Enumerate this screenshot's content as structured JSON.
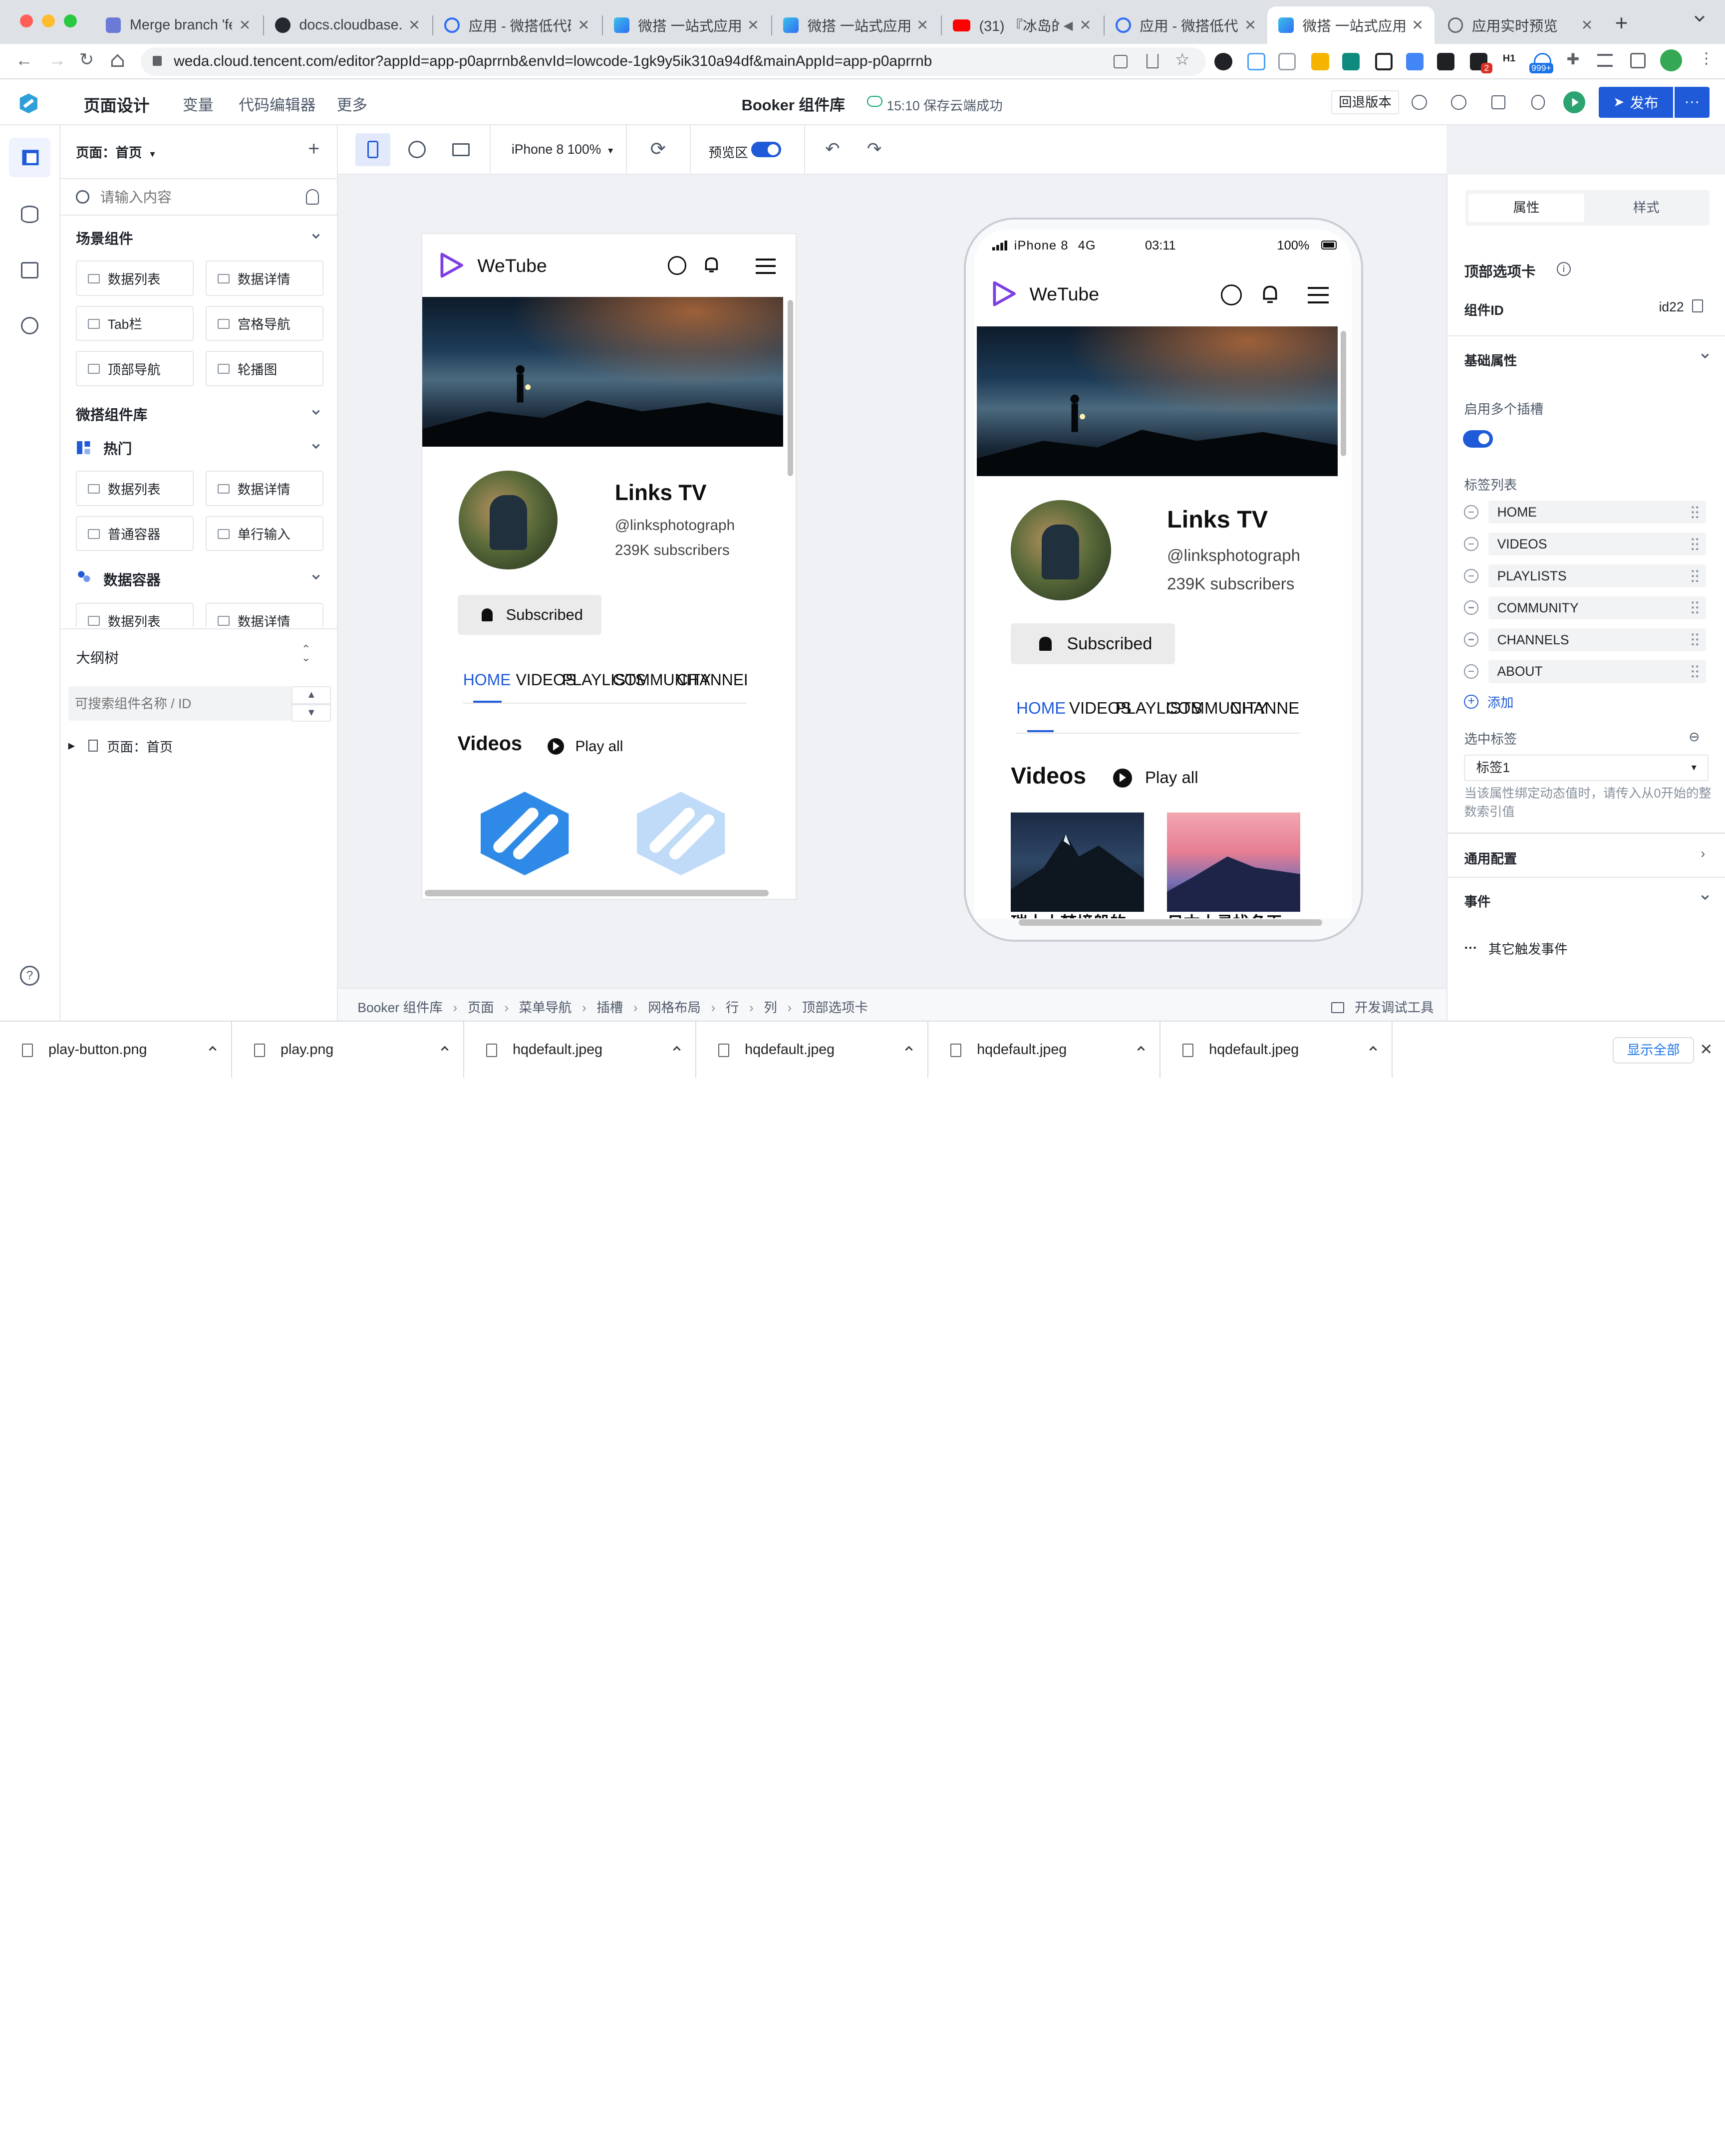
{
  "browser": {
    "tabs": [
      {
        "title": "Merge branch 'fea",
        "icon": "gitlab-icon"
      },
      {
        "title": "docs.cloudbase.ne",
        "icon": "github-icon"
      },
      {
        "title": "应用 - 微搭低代码",
        "icon": "cloud-icon"
      },
      {
        "title": "微搭 一站式应用研",
        "icon": "weda-icon"
      },
      {
        "title": "微搭 一站式应用研",
        "icon": "weda-icon"
      },
      {
        "title": "(31) 『冰岛的",
        "icon": "youtube-icon"
      },
      {
        "title": "应用 - 微搭低代码",
        "icon": "cloud-icon"
      },
      {
        "title": "微搭 一站式应用研",
        "icon": "weda-icon"
      },
      {
        "title": "应用实时预览",
        "icon": "globe-icon"
      }
    ],
    "active_tab": 7,
    "url": "weda.cloud.tencent.com/editor?appId=app-p0aprrnb&envId=lowcode-1gk9y5ik310a94df&mainAppId=app-p0aprrnb",
    "ext_badges": {
      "red": "2",
      "blue": "999+"
    }
  },
  "editor": {
    "title": "页面设计",
    "menus": [
      "变量",
      "代码编辑器",
      "更多"
    ],
    "app_name": "Booker 组件库",
    "save_status": "15:10 保存云端成功",
    "rollback": "回退版本",
    "publish": "发布",
    "brand_color": "#1f5bd9"
  },
  "left_panel": {
    "page_selector": "页面：首页",
    "search_placeholder": "请输入内容",
    "scene_title": "场景组件",
    "scene_items": [
      "数据列表",
      "数据详情",
      "Tab栏",
      "宫格导航",
      "顶部导航",
      "轮播图"
    ],
    "lib_title": "微搭组件库",
    "hot_title": "热门",
    "hot_items": [
      "数据列表",
      "数据详情",
      "普通容器",
      "单行输入"
    ],
    "container_title": "数据容器",
    "container_items": [
      "数据列表",
      "数据详情"
    ],
    "outline_title": "大纲树",
    "outline_placeholder": "可搜索组件名称 / ID",
    "outline_root": "页面：首页"
  },
  "canvas_toolbar": {
    "device": "iPhone 8 100%",
    "preview_label": "预览区",
    "preview_on": true
  },
  "preview": {
    "channel_logo": "WeTube",
    "channel_name": "Links TV",
    "handle": "@linksphotograph",
    "subscribers": "239K subscribers",
    "subscribed_label": "Subscribed",
    "tabs_overlapped": [
      "HOME",
      "VIDEOS",
      "PLAYLISTS",
      "COMMUNITY",
      "CHANNELS"
    ],
    "videos_title": "Videos",
    "play_all": "Play all",
    "status_bar": {
      "carrier": "iPhone 8",
      "network": "4G",
      "time": "03:11",
      "battery": "100%"
    },
    "thumb_captions": [
      "瑞士丨梦境般的",
      "日本丨寻找冬天"
    ]
  },
  "right_panel": {
    "tab_attr": "属性",
    "tab_style": "样式",
    "component_title": "顶部选项卡",
    "component_id_label": "组件ID",
    "component_id": "id22",
    "basic_props": "基础属性",
    "multi_slot_label": "启用多个插槽",
    "multi_slot_on": true,
    "tag_list_label": "标签列表",
    "tags": [
      "HOME",
      "VIDEOS",
      "PLAYLISTS",
      "COMMUNITY",
      "CHANNELS",
      "ABOUT"
    ],
    "add_label": "添加",
    "selected_tag_label": "选中标签",
    "selected_tag_value": "标签1",
    "hint": "当该属性绑定动态值时，请传入从0开始的整数索引值",
    "general_config": "通用配置",
    "events": "事件",
    "other_events": "其它触发事件"
  },
  "breadcrumb": {
    "items": [
      "Booker 组件库",
      "页面",
      "菜单导航",
      "插槽",
      "网格布局",
      "行",
      "列",
      "顶部选项卡"
    ],
    "devtools": "开发调试工具"
  },
  "downloads": {
    "files": [
      "play-button.png",
      "play.png",
      "hqdefault.jpeg",
      "hqdefault.jpeg",
      "hqdefault.jpeg",
      "hqdefault.jpeg"
    ],
    "show_all": "显示全部"
  }
}
